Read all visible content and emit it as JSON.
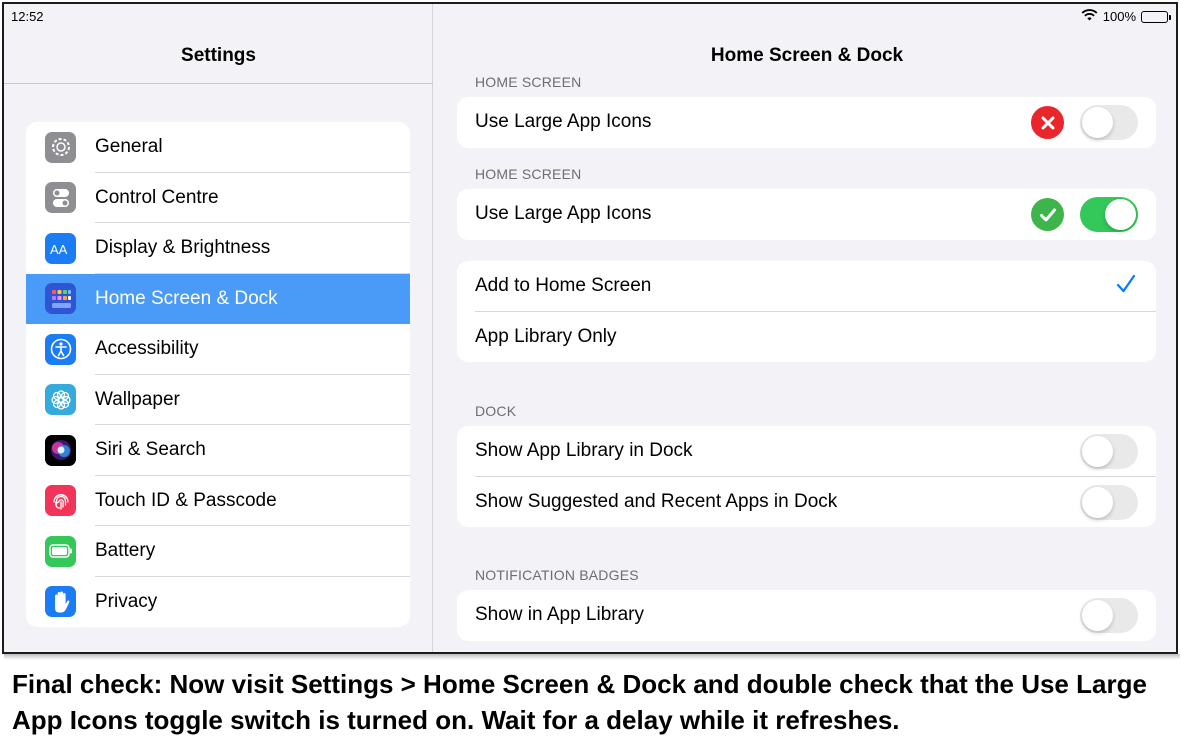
{
  "status_bar": {
    "time": "12:52",
    "battery": "100%"
  },
  "sidebar": {
    "title": "Settings",
    "items": [
      {
        "label": "General",
        "icon": "gear-icon",
        "color": "#8e8e93"
      },
      {
        "label": "Control Centre",
        "icon": "switches-icon",
        "color": "#8e8e93"
      },
      {
        "label": "Display & Brightness",
        "icon": "text-size-icon",
        "color": "#1c7cf4"
      },
      {
        "label": "Home Screen & Dock",
        "icon": "app-grid-icon",
        "color": "#2f55d4",
        "active": true
      },
      {
        "label": "Accessibility",
        "icon": "accessibility-icon",
        "color": "#1c7cf4"
      },
      {
        "label": "Wallpaper",
        "icon": "flower-icon",
        "color": "#35aadc"
      },
      {
        "label": "Siri & Search",
        "icon": "siri-icon",
        "color": "#000000"
      },
      {
        "label": "Touch ID & Passcode",
        "icon": "fingerprint-icon",
        "color": "#f2345a"
      },
      {
        "label": "Battery",
        "icon": "battery-icon",
        "color": "#34c759"
      },
      {
        "label": "Privacy",
        "icon": "hand-icon",
        "color": "#1c7cf4"
      }
    ]
  },
  "detail": {
    "title": "Home Screen & Dock",
    "sections": [
      {
        "header": "HOME SCREEN",
        "rows": [
          {
            "label": "Use Large App Icons",
            "toggle": false,
            "marker": "cross-mark-icon"
          }
        ]
      },
      {
        "header": "HOME SCREEN",
        "rows": [
          {
            "label": "Use Large App Icons",
            "toggle": true,
            "marker": "check-mark-icon"
          }
        ]
      },
      {
        "header": "",
        "rows": [
          {
            "label": "Add to Home Screen",
            "checked": true
          },
          {
            "label": "App Library Only",
            "checked": false
          }
        ]
      },
      {
        "header": "DOCK",
        "rows": [
          {
            "label": "Show App Library in Dock",
            "toggle": false
          },
          {
            "label": "Show Suggested and Recent Apps in Dock",
            "toggle": false
          }
        ]
      },
      {
        "header": "NOTIFICATION BADGES",
        "rows": [
          {
            "label": "Show in App Library",
            "toggle": false
          }
        ]
      }
    ]
  },
  "colors": {
    "accent": "#007aff",
    "toggle_on": "#34c759",
    "selected_row": "#4a9af7",
    "error_red": "#e8262c",
    "success_green": "#3db54a"
  },
  "caption": "Final check: Now visit Settings > Home Screen & Dock and double check that the Use Large App Icons toggle switch is turned on. Wait for a delay while it refreshes."
}
